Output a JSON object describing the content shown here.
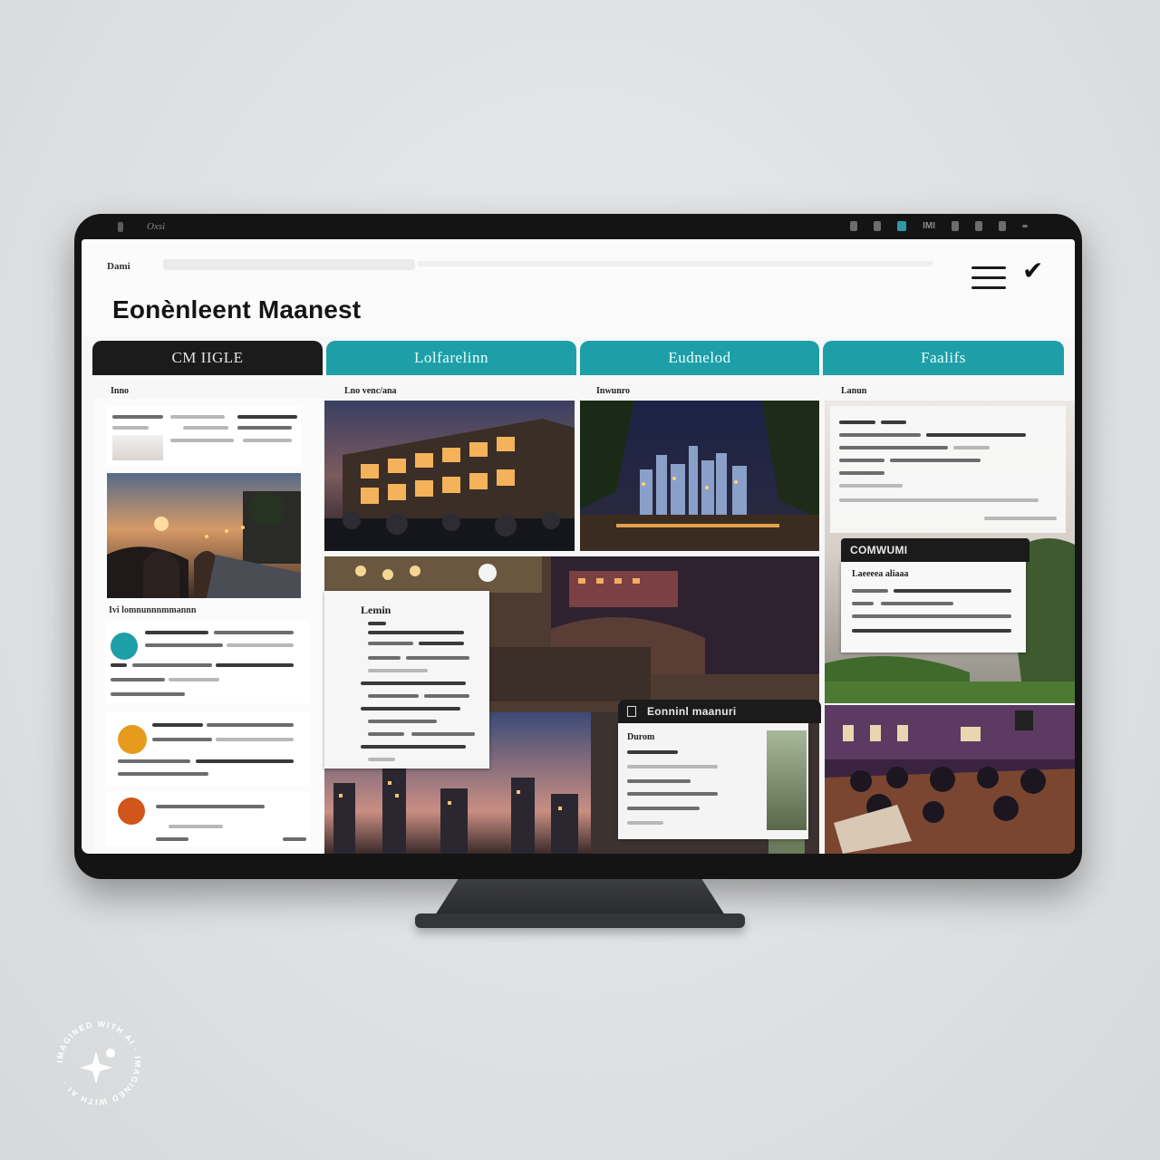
{
  "window": {
    "app_label": "Oxsi",
    "tray_label": "IMI"
  },
  "header": {
    "breadcrumb": "Dami",
    "title": "Eonènleent Maanest"
  },
  "tabs": [
    {
      "label": "CM IIGLE",
      "style": "dark"
    },
    {
      "label": "Lolfarelinn",
      "style": "teal"
    },
    {
      "label": "Eudnelod",
      "style": "teal"
    },
    {
      "label": "Faalifs",
      "style": "teal"
    }
  ],
  "columns": {
    "col1_label": "Inno",
    "col2_label": "Lno venc/ana",
    "col3_label": "Inwunro",
    "col4_label": "Lanun",
    "col1_caption": "Ivi lomnunnnmmannn"
  },
  "cards": {
    "menu_title": "Lemin",
    "dark_card_header": "COMWUMI",
    "dark_card_title": "Laeeeea aliaaa",
    "evening_card_header": "Eonninl maanuri",
    "evening_card_title": "Durom"
  },
  "watermark": {
    "text": "IMAGINED WITH AI · IMAGINED WITH AI ·"
  },
  "colors": {
    "accent": "#1e9fa8",
    "dark": "#1b1b1b",
    "badge_orange": "#e79b1c",
    "badge_red": "#d0561a"
  }
}
